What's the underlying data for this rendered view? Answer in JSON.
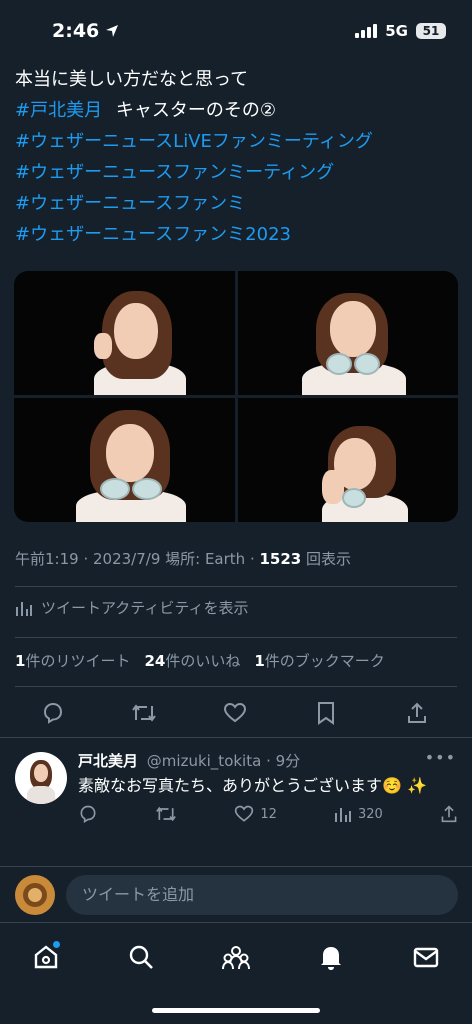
{
  "status_bar": {
    "time": "2:46",
    "network": "5G",
    "battery": "51"
  },
  "tweet": {
    "line1": "本当に美しい方だなと思って",
    "line2_hashtag": "#戸北美月",
    "line2_text": "キャスターのその②",
    "hashtags": [
      "#ウェザーニュースLiVEファンミーティング",
      "#ウェザーニュースファンミーティング",
      "#ウェザーニュースファンミ",
      "#ウェザーニュースファンミ2023"
    ],
    "meta_prefix": "午前1:19 · 2023/7/9 場所: Earth · ",
    "views_count": "1523",
    "views_label": "回表示",
    "activity_label": "ツイートアクティビティを表示",
    "retweets_count": "1",
    "retweets_label": "件のリツイート",
    "likes_count": "24",
    "likes_label": "件のいいね",
    "bookmarks_count": "1",
    "bookmarks_label": "件のブックマーク"
  },
  "reply": {
    "name": "戸北美月",
    "handle": "@mizuki_tokita · 9分",
    "text": "素敵なお写真たち、ありがとうございます☺️ ✨",
    "likes": "12",
    "views": "320"
  },
  "composer": {
    "placeholder": "ツイートを追加"
  },
  "icons": {
    "reply": "comment-icon",
    "retweet": "retweet-icon",
    "like": "heart-icon",
    "bookmark": "bookmark-icon",
    "share": "share-icon",
    "nav": [
      "home-icon",
      "search-icon",
      "communities-icon",
      "notifications-icon",
      "messages-icon"
    ]
  },
  "colors": {
    "background": "#15202b",
    "accent": "#1d9bf0",
    "muted": "#8b98a5"
  }
}
